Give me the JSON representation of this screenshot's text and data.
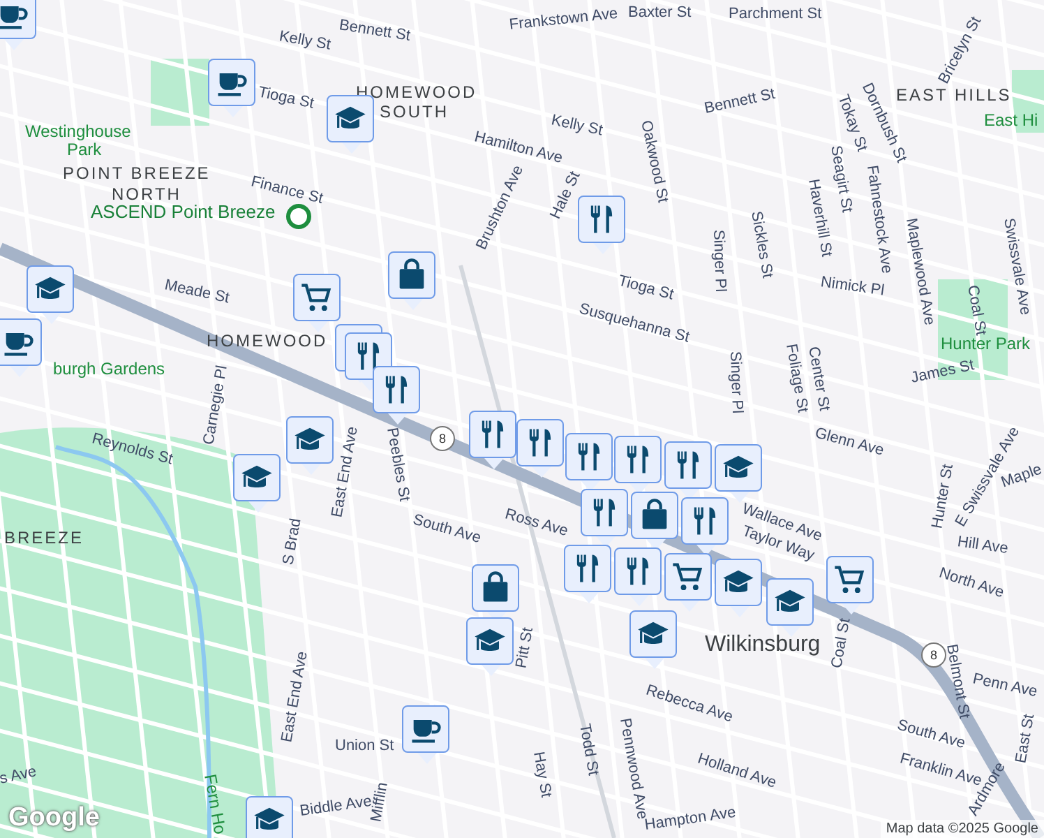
{
  "map": {
    "labels": [
      {
        "text": "Bennett St",
        "kind": "street"
      },
      {
        "text": "Frankstown Ave",
        "kind": "street"
      },
      {
        "text": "Baxter St",
        "kind": "street"
      },
      {
        "text": "Parchment St",
        "kind": "street"
      },
      {
        "text": "Bricelyn St",
        "kind": "street"
      },
      {
        "text": "Kelly St",
        "kind": "street"
      },
      {
        "text": "Bennett St",
        "kind": "street"
      },
      {
        "text": "Tioga St",
        "kind": "street"
      },
      {
        "text": "HOMEWOOD",
        "kind": "area"
      },
      {
        "text": "SOUTH",
        "kind": "area"
      },
      {
        "text": "EAST HILLS",
        "kind": "area"
      },
      {
        "text": "Westinghouse",
        "kind": "park"
      },
      {
        "text": "Park",
        "kind": "park"
      },
      {
        "text": "POINT BREEZE",
        "kind": "area"
      },
      {
        "text": "NORTH",
        "kind": "area"
      },
      {
        "text": "Kelly St",
        "kind": "street"
      },
      {
        "text": "Hamilton Ave",
        "kind": "street"
      },
      {
        "text": "Finance St",
        "kind": "street"
      },
      {
        "text": "ASCEND Point Breeze",
        "kind": "place"
      },
      {
        "text": "Oakwood St",
        "kind": "street"
      },
      {
        "text": "Brushton Ave",
        "kind": "street"
      },
      {
        "text": "Hale St",
        "kind": "street"
      },
      {
        "text": "Tokay St",
        "kind": "street"
      },
      {
        "text": "Dornbush St",
        "kind": "street"
      },
      {
        "text": "Seagirt St",
        "kind": "street"
      },
      {
        "text": "Haverhill St",
        "kind": "street"
      },
      {
        "text": "Fahnestock Ave",
        "kind": "street"
      },
      {
        "text": "Sickles St",
        "kind": "street"
      },
      {
        "text": "Nimick Pl",
        "kind": "street"
      },
      {
        "text": "East Hi",
        "kind": "park"
      },
      {
        "text": "Meade St",
        "kind": "street"
      },
      {
        "text": "Tioga St",
        "kind": "street"
      },
      {
        "text": "Susquehanna St",
        "kind": "street"
      },
      {
        "text": "Singer Pl",
        "kind": "street"
      },
      {
        "text": "Singer Pl",
        "kind": "street"
      },
      {
        "text": "Maplewood Ave",
        "kind": "street"
      },
      {
        "text": "Coal St",
        "kind": "street"
      },
      {
        "text": "Swissvale Ave",
        "kind": "street"
      },
      {
        "text": "Center St",
        "kind": "street"
      },
      {
        "text": "Foliage St",
        "kind": "street"
      },
      {
        "text": "HOMEWOOD",
        "kind": "area"
      },
      {
        "text": "burgh Gardens",
        "kind": "park"
      },
      {
        "text": "Hunter Park",
        "kind": "park"
      },
      {
        "text": "James St",
        "kind": "street"
      },
      {
        "text": "Carnegie Pl",
        "kind": "street"
      },
      {
        "text": "Reynolds St",
        "kind": "street"
      },
      {
        "text": "Glenn Ave",
        "kind": "street"
      },
      {
        "text": "Hunter St",
        "kind": "street"
      },
      {
        "text": "E Swissvale Ave",
        "kind": "street"
      },
      {
        "text": "Maple",
        "kind": "street"
      },
      {
        "text": "East End Ave",
        "kind": "street"
      },
      {
        "text": "Peebles St",
        "kind": "street"
      },
      {
        "text": "S Brad",
        "kind": "street"
      },
      {
        "text": "BREEZE",
        "kind": "area"
      },
      {
        "text": "South Ave",
        "kind": "street"
      },
      {
        "text": "Ross Ave",
        "kind": "street"
      },
      {
        "text": "Wallace Ave",
        "kind": "street"
      },
      {
        "text": "Taylor Way",
        "kind": "street"
      },
      {
        "text": "Hill Ave",
        "kind": "street"
      },
      {
        "text": "North Ave",
        "kind": "street"
      },
      {
        "text": "Wilkinsburg",
        "kind": "town"
      },
      {
        "text": "Pitt St",
        "kind": "street"
      },
      {
        "text": "Coal St",
        "kind": "street"
      },
      {
        "text": "Belmont St",
        "kind": "street"
      },
      {
        "text": "East St",
        "kind": "street"
      },
      {
        "text": "Penn Ave",
        "kind": "street"
      },
      {
        "text": "Rebecca Ave",
        "kind": "street"
      },
      {
        "text": "South Ave",
        "kind": "street"
      },
      {
        "text": "Franklin Ave",
        "kind": "street"
      },
      {
        "text": "Holland Ave",
        "kind": "street"
      },
      {
        "text": "Ardmore",
        "kind": "street"
      },
      {
        "text": "Hay St",
        "kind": "street"
      },
      {
        "text": "Todd St",
        "kind": "street"
      },
      {
        "text": "Pennwood Ave",
        "kind": "street"
      },
      {
        "text": "Union St",
        "kind": "street"
      },
      {
        "text": "Biddle Ave",
        "kind": "street"
      },
      {
        "text": "Hampton Ave",
        "kind": "street"
      },
      {
        "text": "Mifflin",
        "kind": "street"
      },
      {
        "text": "s Ave",
        "kind": "street"
      },
      {
        "text": "East End Ave",
        "kind": "street"
      },
      {
        "text": "Fern Ho",
        "kind": "park"
      }
    ],
    "route_shields": [
      {
        "text": "8"
      },
      {
        "text": "8"
      }
    ],
    "pins": [
      {
        "kind": "cafe"
      },
      {
        "kind": "cafe"
      },
      {
        "kind": "school"
      },
      {
        "kind": "restaurant"
      },
      {
        "kind": "shopping"
      },
      {
        "kind": "grocery"
      },
      {
        "kind": "school"
      },
      {
        "kind": "cafe"
      },
      {
        "kind": "restaurant"
      },
      {
        "kind": "restaurant"
      },
      {
        "kind": "restaurant"
      },
      {
        "kind": "restaurant"
      },
      {
        "kind": "restaurant"
      },
      {
        "kind": "restaurant"
      },
      {
        "kind": "restaurant"
      },
      {
        "kind": "restaurant"
      },
      {
        "kind": "school"
      },
      {
        "kind": "restaurant"
      },
      {
        "kind": "shopping"
      },
      {
        "kind": "restaurant"
      },
      {
        "kind": "restaurant"
      },
      {
        "kind": "restaurant"
      },
      {
        "kind": "grocery"
      },
      {
        "kind": "school"
      },
      {
        "kind": "school"
      },
      {
        "kind": "school"
      },
      {
        "kind": "grocery"
      },
      {
        "kind": "school"
      },
      {
        "kind": "school"
      },
      {
        "kind": "shopping"
      },
      {
        "kind": "school"
      },
      {
        "kind": "cafe"
      },
      {
        "kind": "school"
      }
    ],
    "logo": "Google",
    "attribution": "Map data ©2025 Google"
  }
}
